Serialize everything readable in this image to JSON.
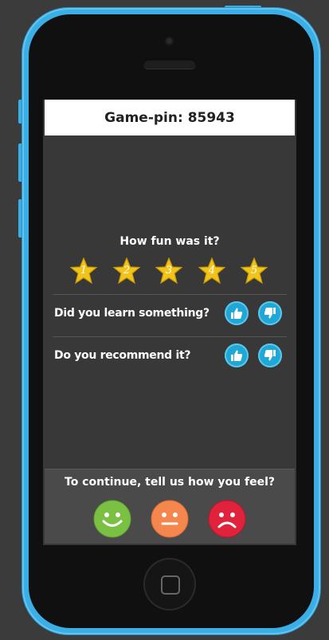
{
  "game_pin": "Game-pin: 85943",
  "rating": {
    "question": "How fun was it?",
    "stars": [
      "1",
      "2",
      "3",
      "4",
      "5"
    ],
    "star_color": "#f2c318"
  },
  "questions": [
    {
      "label": "Did you learn something?",
      "up_icon": "thumbs-up-icon",
      "down_icon": "thumbs-down-icon"
    },
    {
      "label": "Do you recommend it?",
      "up_icon": "thumbs-up-icon",
      "down_icon": "thumbs-down-icon"
    }
  ],
  "footer": {
    "prompt": "To continue, tell us how you feel?",
    "moods": [
      {
        "name": "happy-face-icon",
        "color": "#7ac143"
      },
      {
        "name": "neutral-face-icon",
        "color": "#f5864e"
      },
      {
        "name": "sad-face-icon",
        "color": "#e0223c"
      }
    ]
  },
  "colors": {
    "phone_body": "#3aaee5",
    "thumb_button": "#1fa7d6"
  }
}
